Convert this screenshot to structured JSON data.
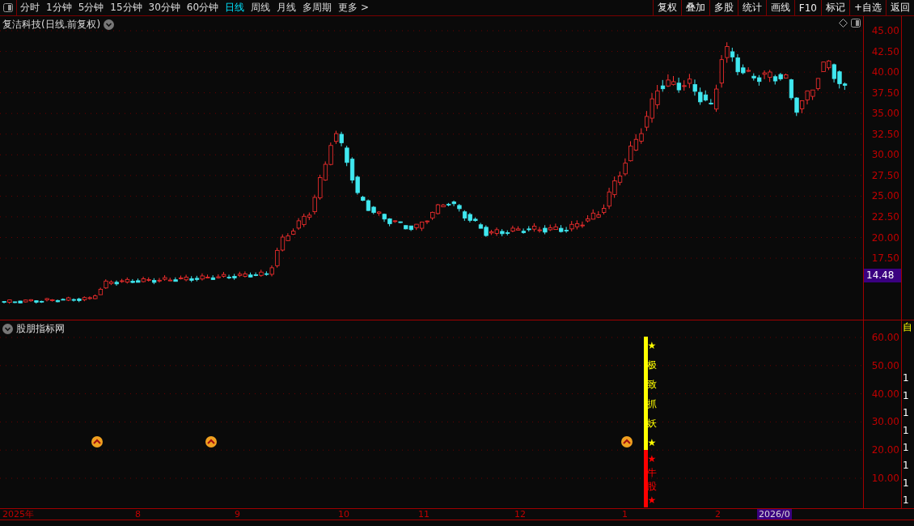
{
  "toolbar": {
    "periods": [
      {
        "label": "分时",
        "selected": false
      },
      {
        "label": "1分钟",
        "selected": false
      },
      {
        "label": "5分钟",
        "selected": false
      },
      {
        "label": "15分钟",
        "selected": false
      },
      {
        "label": "30分钟",
        "selected": false
      },
      {
        "label": "60分钟",
        "selected": false
      },
      {
        "label": "日线",
        "selected": true
      },
      {
        "label": "周线",
        "selected": false
      },
      {
        "label": "月线",
        "selected": false
      },
      {
        "label": "多周期",
        "selected": false
      },
      {
        "label": "更多 >",
        "selected": false
      }
    ],
    "actions": [
      "复权",
      "叠加",
      "多股",
      "统计",
      "画线",
      "F10",
      "标记",
      "+自选",
      "返回"
    ]
  },
  "price_chart": {
    "title": "复洁科技(日线.前复权)",
    "ticks": [
      "45.00",
      "42.50",
      "40.00",
      "37.50",
      "35.00",
      "32.50",
      "30.00",
      "27.50",
      "25.00",
      "22.50",
      "20.00",
      "17.50"
    ],
    "last_price": "14.48"
  },
  "indicator": {
    "title": "股朋指标网",
    "ticks": [
      "60.00",
      "50.00",
      "40.00",
      "30.00",
      "20.00",
      "10.00"
    ],
    "segments": [
      {
        "color": "#ffff00",
        "marks": [
          "★",
          "极",
          "致",
          "抓",
          "妖",
          "★"
        ]
      },
      {
        "color": "#ff0000",
        "marks": [
          "★",
          "牛",
          "股",
          "★"
        ]
      }
    ]
  },
  "side_panel": {
    "header": "自",
    "values": [
      "1",
      "1",
      "1",
      "1",
      "1",
      "1",
      "1",
      "1"
    ]
  },
  "date_axis": {
    "labels": [
      "2025年",
      "8",
      "9",
      "10",
      "11",
      "12",
      "1",
      "2"
    ],
    "current": "2026/0"
  }
}
